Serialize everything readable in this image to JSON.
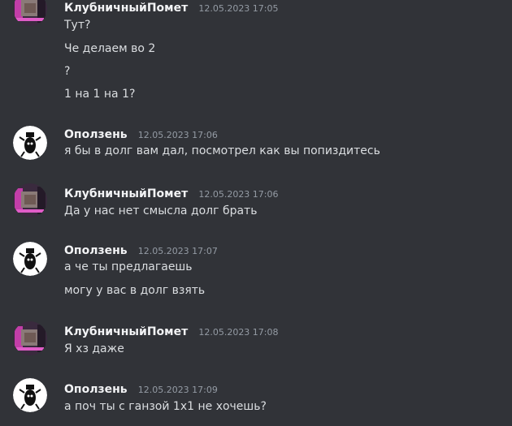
{
  "users": {
    "klub": "КлубничныйПомет",
    "opol": "Оползень"
  },
  "messages": [
    {
      "author": "КлубничныйПомет",
      "time": "12.05.2023 17:05",
      "lines": [
        "Тут?",
        "Че делаем во 2",
        "?",
        "1 на 1 на 1?"
      ]
    },
    {
      "author": "Оползень",
      "time": "12.05.2023 17:06",
      "lines": [
        "я бы в долг вам дал, посмотрел как вы попиздитесь"
      ]
    },
    {
      "author": "КлубничныйПомет",
      "time": "12.05.2023 17:06",
      "lines": [
        "Да у нас нет смысла долг брать"
      ]
    },
    {
      "author": "Оползень",
      "time": "12.05.2023 17:07",
      "lines": [
        "а че ты предлагаешь",
        "могу у вас в долг взять"
      ]
    },
    {
      "author": "КлубничныйПомет",
      "time": "12.05.2023 17:08",
      "lines": [
        "Я хз даже"
      ]
    },
    {
      "author": "Оползень",
      "time": "12.05.2023 17:09",
      "lines": [
        "а поч ты с ганзой 1х1 не хочешь?"
      ]
    }
  ],
  "colors": {
    "background": "#313338",
    "username": "#f2f3f5",
    "timestamp": "#949ba4",
    "text": "#dbdee1"
  }
}
